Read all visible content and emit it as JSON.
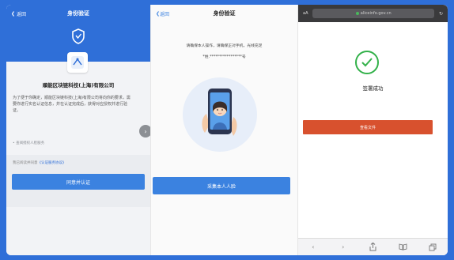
{
  "panel1": {
    "nav": {
      "back_label": "返回",
      "title": "身份验证"
    },
    "company_name": "順能区块链科技(上海)有限公司",
    "description": "为了便于你确定，順能区块链科技(上海)有限公司将向你的要求，需要你进行实名认证信息，并在认证完成后，获得对应授权并进行验证。",
    "help_link": "• 查阅授权人脸服务",
    "agree_text": "我已阅读并同意",
    "agree_link": "《认证服务协议》",
    "button_label": "同意并认证"
  },
  "panel2": {
    "nav": {
      "back_label": "返回",
      "title": "身份验证"
    },
    "hint_line1": "请确保本人操作，请确保正对手机，光线充足",
    "hint_line2": "*姓.*****************号",
    "button_label": "采集本人人脸"
  },
  "panel3": {
    "address_bar": {
      "reader_label": "aA",
      "url": "aliceinfo.gov.cn"
    },
    "success_text": "签署成功",
    "button_label": "查看文件"
  },
  "colors": {
    "brand_blue": "#2f6fd8",
    "button_blue": "#3b82e0",
    "success_green": "#33b14a",
    "accent_red": "#d8512e"
  }
}
